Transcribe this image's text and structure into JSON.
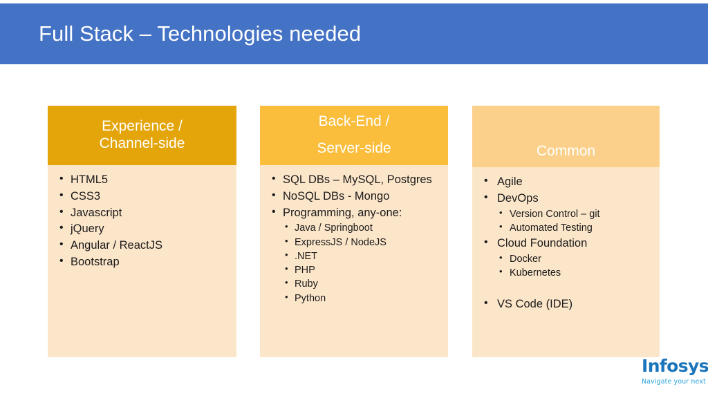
{
  "slide": {
    "title": "Full Stack – Technologies needed",
    "background_color": "#ffffff",
    "title_bar_color": "#4472c4",
    "title_text_color": "#ffffff"
  },
  "columns": [
    {
      "id": "experience",
      "header_lines": [
        "Experience /",
        "Channel-side"
      ],
      "header_color": "#e3a50a",
      "body_color": "#fce6ca",
      "items": [
        {
          "label": "HTML5",
          "sub": []
        },
        {
          "label": "CSS3",
          "sub": []
        },
        {
          "label": "Javascript",
          "sub": []
        },
        {
          "label": "jQuery",
          "sub": []
        },
        {
          "label": "Angular / ReactJS",
          "sub": []
        },
        {
          "label": "Bootstrap",
          "sub": []
        }
      ]
    },
    {
      "id": "backend",
      "header_lines": [
        "Back-End /",
        "Server-side"
      ],
      "header_color": "#fbbe3c",
      "body_color": "#fce6ca",
      "items": [
        {
          "label": "SQL DBs – MySQL, Postgres",
          "sub": []
        },
        {
          "label": "NoSQL DBs - Mongo",
          "sub": []
        },
        {
          "label": "Programming, any-one:",
          "sub": [
            "Java / Springboot",
            "ExpressJS / NodeJS",
            ".NET",
            "PHP",
            "Ruby",
            "Python"
          ]
        }
      ]
    },
    {
      "id": "common",
      "header_lines": [
        "Common"
      ],
      "header_color": "#fbd08a",
      "body_color": "#fce6ca",
      "items": [
        {
          "label": "Agile",
          "sub": []
        },
        {
          "label": "DevOps",
          "sub": [
            "Version Control – git",
            "Automated Testing"
          ]
        },
        {
          "label": "Cloud Foundation",
          "sub": [
            "Docker",
            "Kubernetes"
          ]
        },
        {
          "label": "VS Code (IDE)",
          "sub": [],
          "spacer_before": true
        }
      ]
    }
  ],
  "logo": {
    "name": "Infosys",
    "registered_mark": "®",
    "tagline": "Navigate your next",
    "word_color": "#1b75bb",
    "tagline_color": "#29a3dc"
  }
}
